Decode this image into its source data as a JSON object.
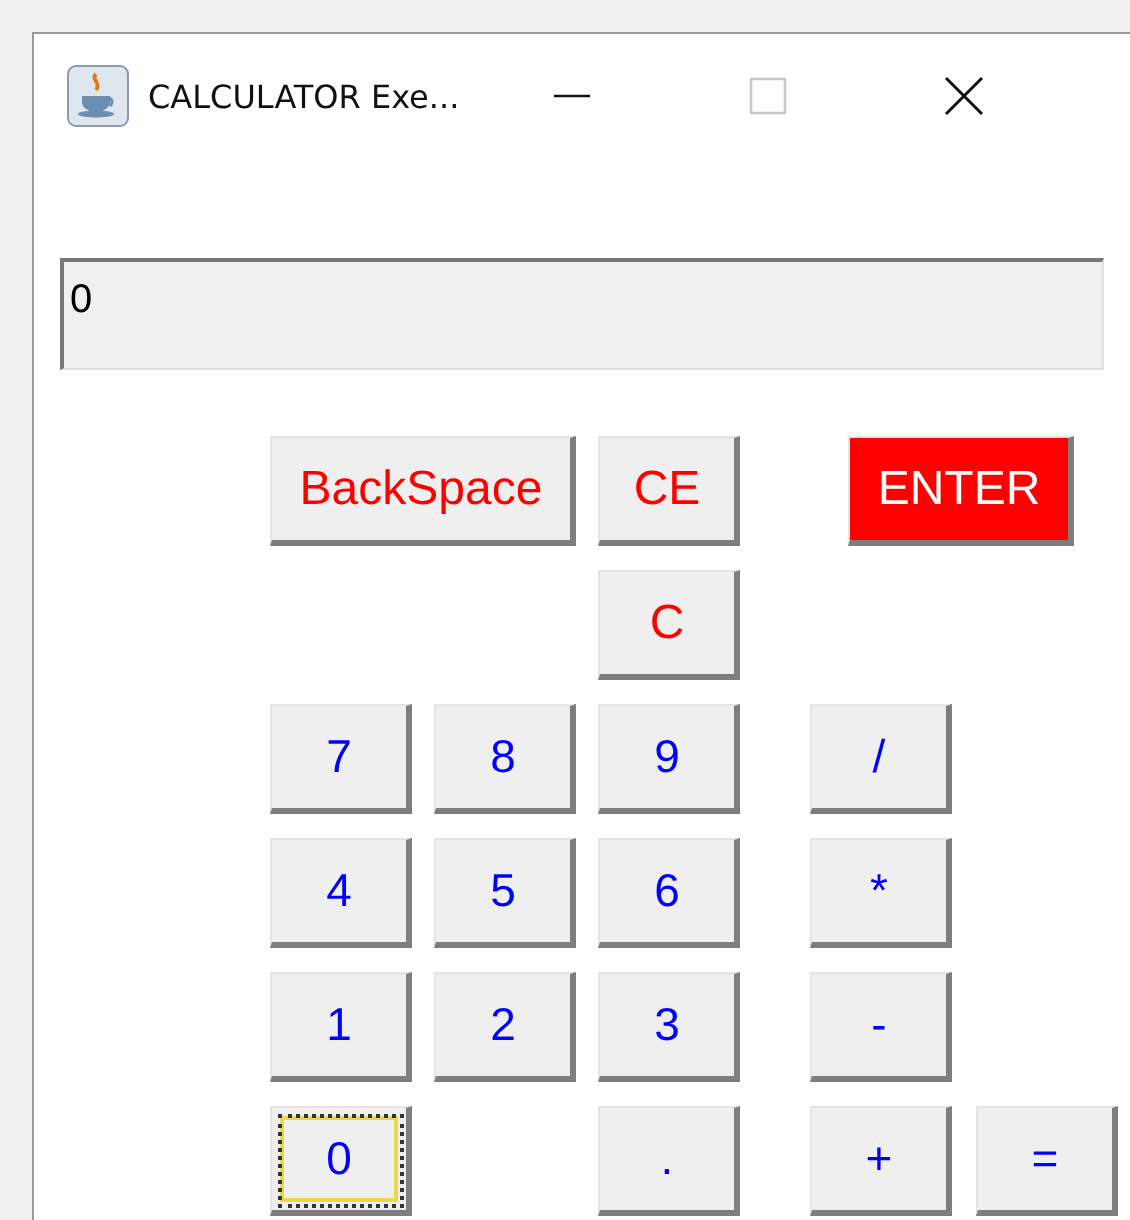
{
  "window": {
    "title": "CALCULATOR Exe..."
  },
  "display": {
    "value": "0"
  },
  "buttons": [
    {
      "label": "BackSpace",
      "kind": "clear",
      "focused": false
    },
    {
      "label": "CE",
      "kind": "clear",
      "focused": false
    },
    {
      "label": "ENTER",
      "kind": "enter",
      "focused": false
    },
    {
      "label": "C",
      "kind": "clear",
      "focused": false
    },
    {
      "label": "7",
      "kind": "digit",
      "focused": false
    },
    {
      "label": "8",
      "kind": "digit",
      "focused": false
    },
    {
      "label": "9",
      "kind": "digit",
      "focused": false
    },
    {
      "label": "/",
      "kind": "digit",
      "focused": false
    },
    {
      "label": "4",
      "kind": "digit",
      "focused": false
    },
    {
      "label": "5",
      "kind": "digit",
      "focused": false
    },
    {
      "label": "6",
      "kind": "digit",
      "focused": false
    },
    {
      "label": "*",
      "kind": "digit",
      "focused": false
    },
    {
      "label": "1",
      "kind": "digit",
      "focused": false
    },
    {
      "label": "2",
      "kind": "digit",
      "focused": false
    },
    {
      "label": "3",
      "kind": "digit",
      "focused": false
    },
    {
      "label": "-",
      "kind": "digit",
      "focused": false
    },
    {
      "label": "0",
      "kind": "digit",
      "focused": true
    },
    {
      "label": ".",
      "kind": "digit",
      "focused": false
    },
    {
      "label": "+",
      "kind": "digit",
      "focused": false
    },
    {
      "label": "=",
      "kind": "digit",
      "focused": false
    }
  ]
}
